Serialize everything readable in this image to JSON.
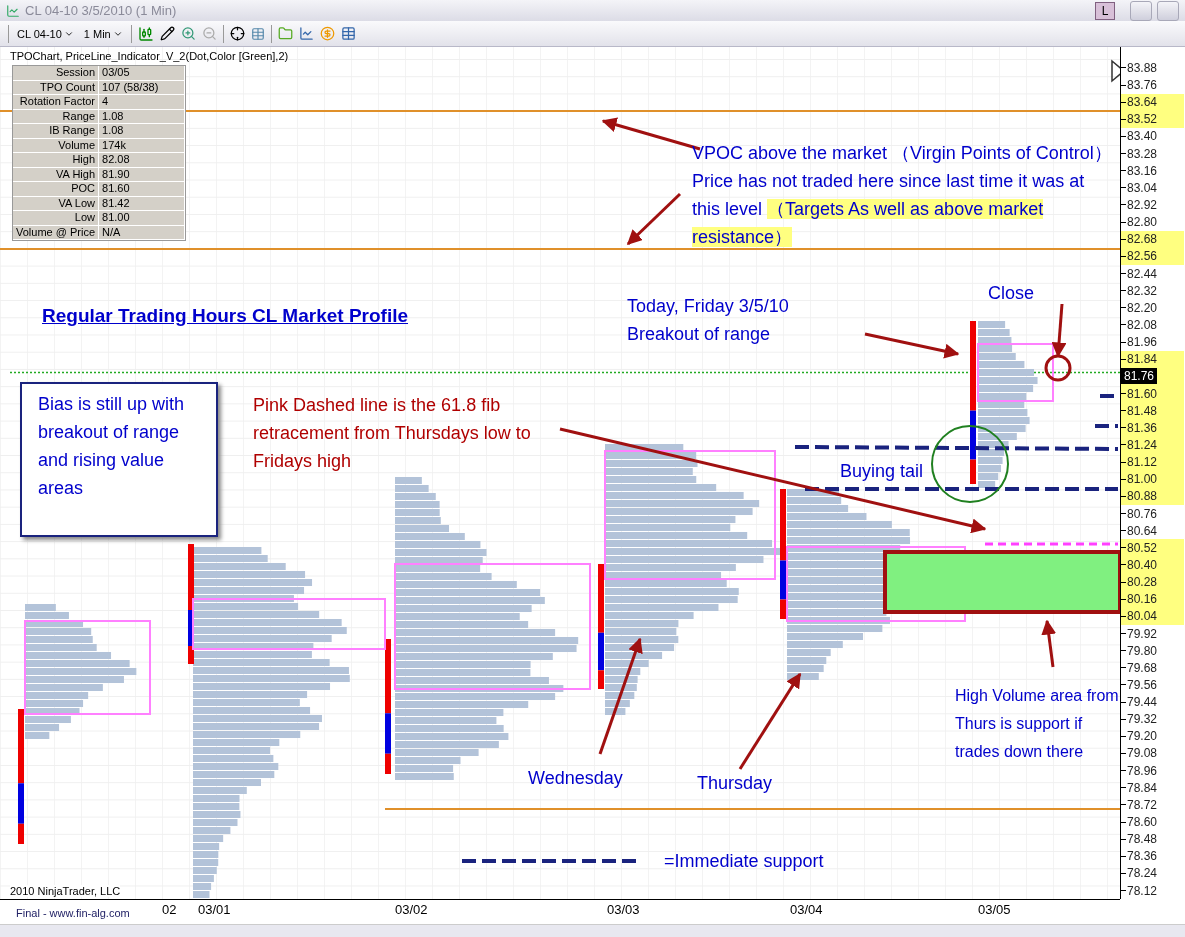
{
  "window": {
    "title": "CL 04-10  3/5/2010 (1 Min)",
    "buttons": [
      "L"
    ]
  },
  "toolbar": {
    "instrument": "CL 04-10",
    "interval": "1 Min"
  },
  "chart": {
    "indicator_label": "TPOChart, PriceLine_Indicator_V_2(Dot,Color [Green],2)",
    "stats": [
      {
        "label": "Session",
        "value": "03/05"
      },
      {
        "label": "TPO Count",
        "value": "107 (58/38)"
      },
      {
        "label": "Rotation Factor",
        "value": "4"
      },
      {
        "label": "Range",
        "value": "1.08"
      },
      {
        "label": "IB Range",
        "value": "1.08"
      },
      {
        "label": "Volume",
        "value": "174k"
      },
      {
        "label": "High",
        "value": "82.08"
      },
      {
        "label": "VA High",
        "value": "81.90"
      },
      {
        "label": "POC",
        "value": "81.60"
      },
      {
        "label": "VA Low",
        "value": "81.42"
      },
      {
        "label": "Low",
        "value": "81.00"
      },
      {
        "label": "Volume @ Price",
        "value": "N/A"
      }
    ],
    "annotations": [
      {
        "kind": "title",
        "text": "Regular Trading Hours CL Market Profile"
      },
      {
        "kind": "boxed",
        "text": "Bias is still up with breakout of range and rising value areas"
      },
      {
        "kind": "red",
        "text": "Pink Dashed line is the 61.8 fib retracement from Thursdays low to Fridays high"
      },
      {
        "kind": "vpoc",
        "segments": [
          {
            "text": "VPOC above the market （Virgin Points of Control） Price has not traded here since last time it was at this level ",
            "highlight": false
          },
          {
            "text": "（Targets As well as above market resistance）",
            "highlight": true
          }
        ]
      },
      {
        "kind": "blue",
        "text": "Today, Friday 3/5/10 Breakout of range"
      },
      {
        "kind": "blue",
        "text": "Close"
      },
      {
        "kind": "blue",
        "text": "Buying tail"
      },
      {
        "kind": "blue",
        "text": "Wednesday"
      },
      {
        "kind": "blue",
        "text": "Thursday"
      },
      {
        "kind": "blue",
        "text": "High Volume area from Thurs is support if trades down there"
      },
      {
        "kind": "blue",
        "text": "=Immediate support"
      }
    ],
    "copyright": "2010 NinjaTrader, LLC",
    "price_axis": [
      {
        "kind": "tick",
        "label": "83.88",
        "highlight": false
      },
      {
        "kind": "tick",
        "label": "83.76",
        "highlight": false
      },
      {
        "kind": "tick",
        "label": "83.64",
        "highlight": true
      },
      {
        "kind": "tick",
        "label": "83.52",
        "highlight": true
      },
      {
        "kind": "tick",
        "label": "83.40",
        "highlight": false
      },
      {
        "kind": "tick",
        "label": "83.28",
        "highlight": false
      },
      {
        "kind": "tick",
        "label": "83.16",
        "highlight": false
      },
      {
        "kind": "tick",
        "label": "83.04",
        "highlight": false
      },
      {
        "kind": "tick",
        "label": "82.92",
        "highlight": false
      },
      {
        "kind": "tick",
        "label": "82.80",
        "highlight": false
      },
      {
        "kind": "tick",
        "label": "82.68",
        "highlight": true
      },
      {
        "kind": "tick",
        "label": "82.56",
        "highlight": true
      },
      {
        "kind": "tick",
        "label": "82.44",
        "highlight": false
      },
      {
        "kind": "tick",
        "label": "82.32",
        "highlight": false
      },
      {
        "kind": "tick",
        "label": "82.20",
        "highlight": false
      },
      {
        "kind": "tick",
        "label": "82.08",
        "highlight": false
      },
      {
        "kind": "tick",
        "label": "81.96",
        "highlight": false
      },
      {
        "kind": "tick",
        "label": "81.84",
        "highlight": true
      },
      {
        "kind": "current",
        "label": "81.76",
        "highlight": true
      },
      {
        "kind": "tick",
        "label": "81.60",
        "highlight": true
      },
      {
        "kind": "tick",
        "label": "81.48",
        "highlight": true
      },
      {
        "kind": "tick",
        "label": "81.36",
        "highlight": true
      },
      {
        "kind": "tick",
        "label": "81.24",
        "highlight": true
      },
      {
        "kind": "tick",
        "label": "81.12",
        "highlight": true
      },
      {
        "kind": "tick",
        "label": "81.00",
        "highlight": true
      },
      {
        "kind": "tick",
        "label": "80.88",
        "highlight": true
      },
      {
        "kind": "tick",
        "label": "80.76",
        "highlight": false
      },
      {
        "kind": "tick",
        "label": "80.64",
        "highlight": false
      },
      {
        "kind": "tick",
        "label": "80.52",
        "highlight": true
      },
      {
        "kind": "tick",
        "label": "80.40",
        "highlight": true
      },
      {
        "kind": "tick",
        "label": "80.28",
        "highlight": true
      },
      {
        "kind": "tick",
        "label": "80.16",
        "highlight": true
      },
      {
        "kind": "tick",
        "label": "80.04",
        "highlight": true
      },
      {
        "kind": "tick",
        "label": "79.92",
        "highlight": false
      },
      {
        "kind": "tick",
        "label": "79.80",
        "highlight": false
      },
      {
        "kind": "tick",
        "label": "79.68",
        "highlight": false
      },
      {
        "kind": "tick",
        "label": "79.56",
        "highlight": false
      },
      {
        "kind": "tick",
        "label": "79.44",
        "highlight": false
      },
      {
        "kind": "tick",
        "label": "79.32",
        "highlight": false
      },
      {
        "kind": "tick",
        "label": "79.20",
        "highlight": false
      },
      {
        "kind": "tick",
        "label": "79.08",
        "highlight": false
      },
      {
        "kind": "tick",
        "label": "78.96",
        "highlight": false
      },
      {
        "kind": "tick",
        "label": "78.84",
        "highlight": false
      },
      {
        "kind": "tick",
        "label": "78.72",
        "highlight": false
      },
      {
        "kind": "tick",
        "label": "78.60",
        "highlight": false
      },
      {
        "kind": "tick",
        "label": "78.48",
        "highlight": false
      },
      {
        "kind": "tick",
        "label": "78.36",
        "highlight": false
      },
      {
        "kind": "tick",
        "label": "78.24",
        "highlight": false
      },
      {
        "kind": "tick",
        "label": "78.12",
        "highlight": false
      }
    ],
    "time_axis": [
      "02",
      "03/01",
      "03/02",
      "03/03",
      "03/04",
      "03/05"
    ],
    "footer": "Final - www.fin-alg.com"
  }
}
